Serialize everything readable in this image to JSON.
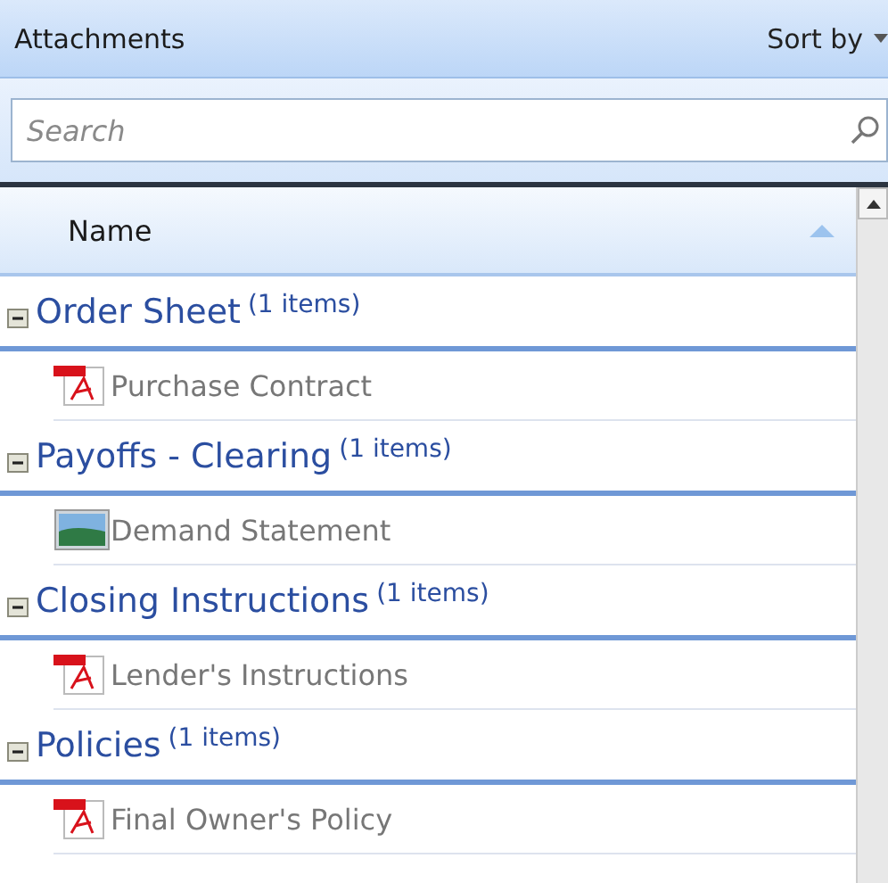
{
  "header": {
    "title": "Attachments",
    "sort_label": "Sort by"
  },
  "search": {
    "placeholder": "Search"
  },
  "table": {
    "columns": [
      {
        "label": "Name",
        "sorted": true
      }
    ],
    "groups": [
      {
        "name": "Order Sheet",
        "count": "(1 items)",
        "expanded": true,
        "files": [
          {
            "name": "Purchase Contract",
            "kind": "pdf"
          }
        ]
      },
      {
        "name": "Payoffs - Clearing",
        "count": "(1 items)",
        "expanded": true,
        "files": [
          {
            "name": "Demand Statement",
            "kind": "image"
          }
        ]
      },
      {
        "name": "Closing Instructions",
        "count": "(1 items)",
        "expanded": true,
        "files": [
          {
            "name": "Lender's Instructions",
            "kind": "pdf"
          }
        ]
      },
      {
        "name": "Policies",
        "count": "(1 items)",
        "expanded": true,
        "files": [
          {
            "name": "Final Owner's Policy",
            "kind": "pdf"
          }
        ]
      }
    ]
  }
}
